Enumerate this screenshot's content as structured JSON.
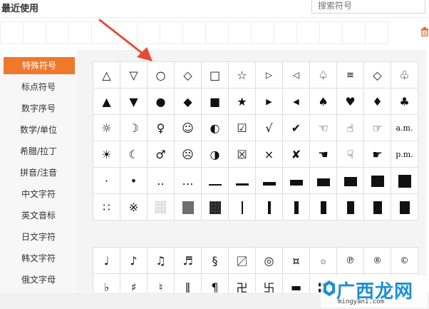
{
  "recent": {
    "title": "最近使用"
  },
  "search": {
    "placeholder": "搜索符号"
  },
  "sidebar": {
    "items": [
      {
        "label": "特殊符号"
      },
      {
        "label": "标点符号"
      },
      {
        "label": "数字序号"
      },
      {
        "label": "数学/单位"
      },
      {
        "label": "希腊/拉丁"
      },
      {
        "label": "拼音/注音"
      },
      {
        "label": "中文字符"
      },
      {
        "label": "英文音标"
      },
      {
        "label": "日文字符"
      },
      {
        "label": "韩文字符"
      },
      {
        "label": "俄文字母"
      }
    ],
    "active_index": 0
  },
  "symbols_grid": {
    "rows": [
      [
        "△",
        "▽",
        "○",
        "◇",
        "□",
        "☆",
        "▷",
        "◁",
        "♤",
        "≡",
        "◇",
        "♧"
      ],
      [
        "▲",
        "▼",
        "●",
        "◆",
        "■",
        "★",
        "▶",
        "◀",
        "♠",
        "♥",
        "♦",
        "♣"
      ],
      [
        "☼",
        "☽",
        "♀",
        "☺",
        "◐",
        "☑",
        "√",
        "✔",
        "☜",
        "☝",
        "☞",
        "a.m."
      ],
      [
        "☀",
        "☾",
        "♂",
        "☹",
        "◑",
        "☒",
        "×",
        "✘",
        "☚",
        "☟",
        "☛",
        "p.m."
      ],
      [
        "·",
        "•",
        "‥",
        "…",
        "",
        "",
        "",
        "",
        "",
        "",
        "",
        ""
      ],
      [
        "∷",
        "※",
        "",
        "",
        "",
        "",
        "",
        "",
        "",
        "",
        "",
        ""
      ]
    ]
  },
  "symbols_grid2": {
    "rows": [
      [
        "♩",
        "♪",
        "♫",
        "♬",
        "§",
        "〼",
        "◎",
        "¤",
        "۞",
        "℗",
        "®",
        "©"
      ],
      [
        "♭",
        "♯",
        "♮",
        "‖",
        "¶",
        "卍",
        "卐",
        "▬",
        "〓",
        "",
        "",
        ""
      ]
    ]
  },
  "watermark": {
    "main": "广西龙网",
    "sub": "mingyan1.com"
  },
  "colors": {
    "accent": "#f0782a",
    "watermark": "#1d8fd6",
    "arrow": "#e84a3a"
  }
}
